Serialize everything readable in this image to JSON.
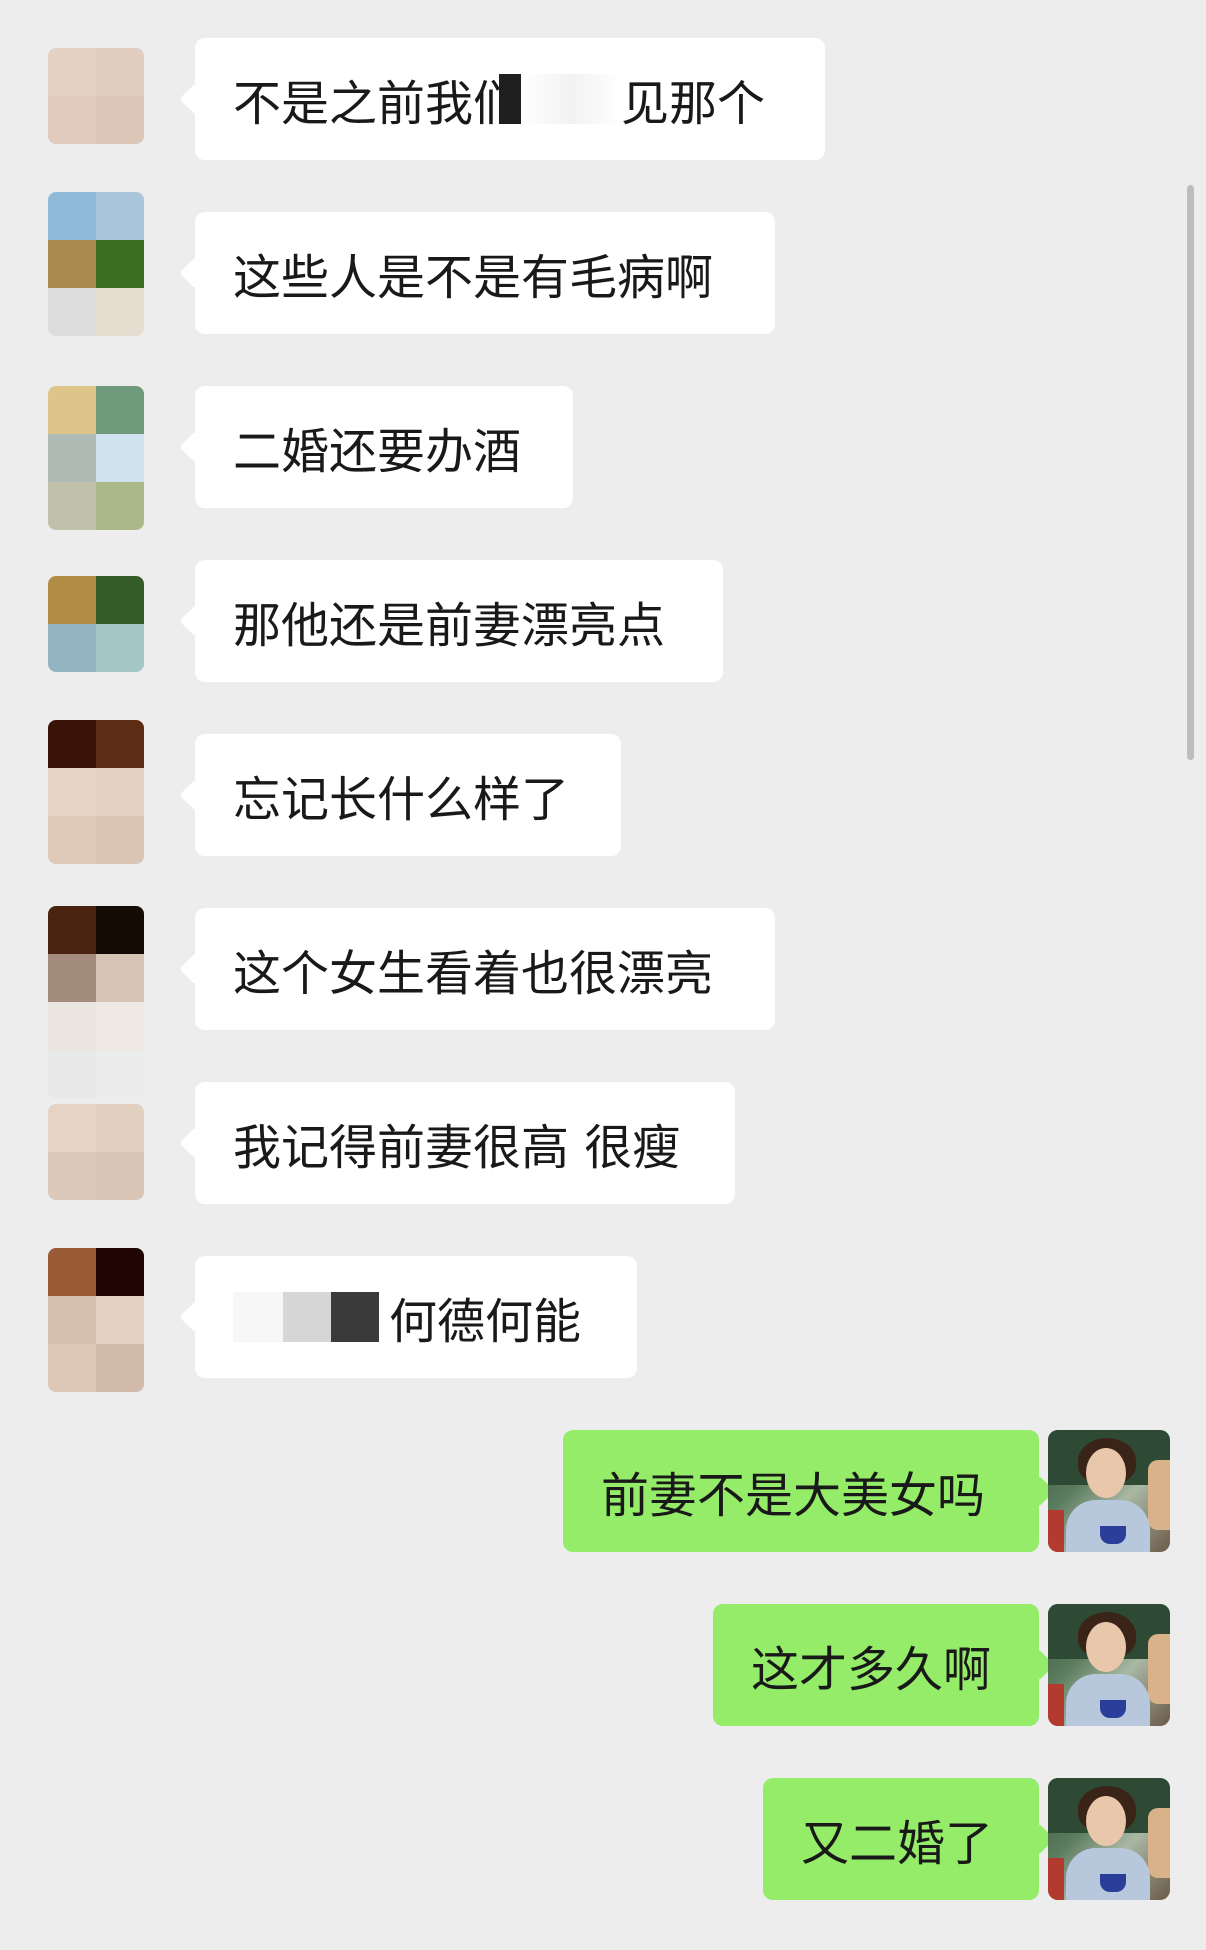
{
  "messages": [
    {
      "side": "in",
      "text_before": "不是之前我们",
      "text_after": "见那个"
    },
    {
      "side": "in",
      "text": "这些人是不是有毛病啊"
    },
    {
      "side": "in",
      "text": "二婚还要办酒"
    },
    {
      "side": "in",
      "text": "那他还是前妻漂亮点"
    },
    {
      "side": "in",
      "text": "忘记长什么样了"
    },
    {
      "side": "in",
      "text": "这个女生看着也很漂亮"
    },
    {
      "side": "in",
      "text": "我记得前妻很高 很瘦"
    },
    {
      "side": "in",
      "text": "何德何能"
    },
    {
      "side": "out",
      "text": "前妻不是大美女吗"
    },
    {
      "side": "out",
      "text": "这才多久啊"
    },
    {
      "side": "out",
      "text": "又二婚了"
    }
  ],
  "colors": {
    "background": "#ededed",
    "incoming_bubble": "#ffffff",
    "outgoing_bubble": "#95ec69",
    "text": "#191919"
  },
  "icons": {
    "incoming_avatar": "pixelated-avatar",
    "outgoing_avatar": "user-photo-avatar"
  }
}
